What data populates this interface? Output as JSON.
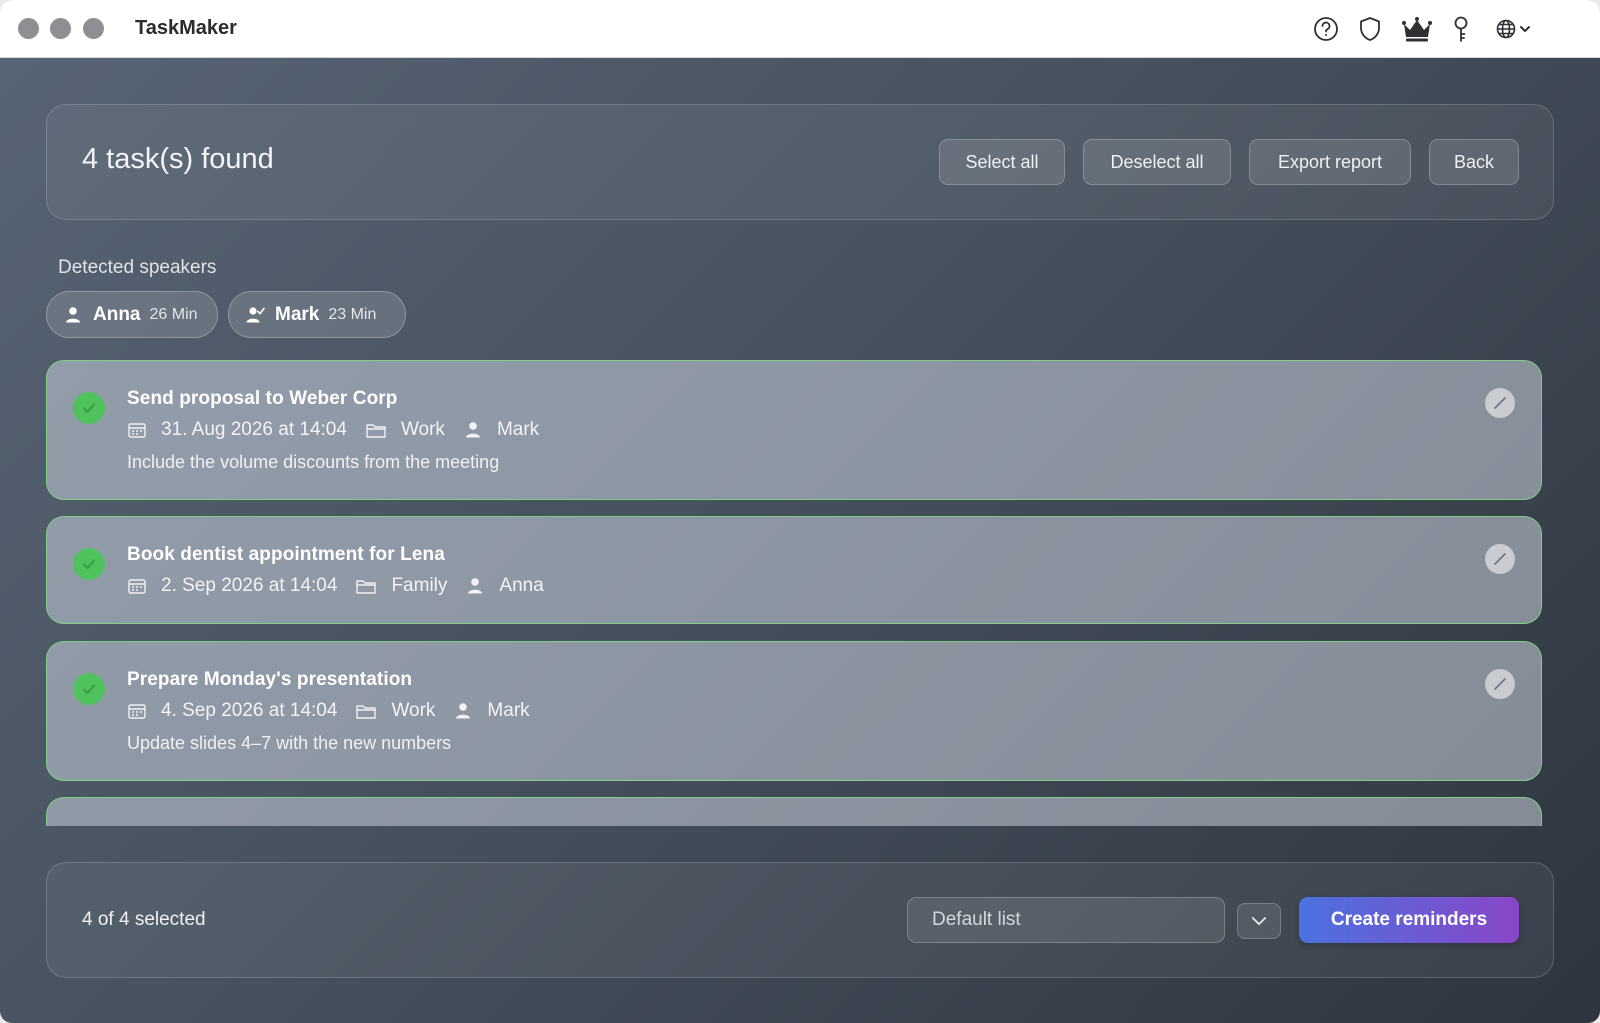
{
  "window": {
    "title": "TaskMaker"
  },
  "toolbar_icons": [
    "help-icon",
    "shield-icon",
    "crown-icon",
    "key-icon",
    "globe-icon"
  ],
  "header": {
    "title": "4 task(s) found",
    "buttons": {
      "select_all": "Select all",
      "deselect_all": "Deselect all",
      "export": "Export report",
      "back": "Back"
    }
  },
  "speakers": {
    "label": "Detected speakers",
    "items": [
      {
        "name": "Anna",
        "duration": "26 Min",
        "icon": "person-icon"
      },
      {
        "name": "Mark",
        "duration": "23 Min",
        "icon": "person-check-icon"
      }
    ]
  },
  "tasks": [
    {
      "title": "Send proposal to Weber Corp",
      "date": "31. Aug 2026 at 14:04",
      "list": "Work",
      "person": "Mark",
      "note": "Include the volume discounts from the meeting",
      "selected": true
    },
    {
      "title": "Book dentist appointment for Lena",
      "date": "2. Sep 2026 at 14:04",
      "list": "Family",
      "person": "Anna",
      "note": "",
      "selected": true
    },
    {
      "title": "Prepare Monday's presentation",
      "date": "4. Sep 2026 at 14:04",
      "list": "Work",
      "person": "Mark",
      "note": "Update slides 4–7 with the new numbers",
      "selected": true
    }
  ],
  "footer": {
    "selected_text": "4 of 4 selected",
    "list_placeholder": "Default list",
    "create_label": "Create reminders"
  },
  "colors": {
    "accent_start": "#4a72e0",
    "accent_end": "#8a46c8",
    "check": "#4fc25e",
    "task_border": "#7fcf86"
  }
}
